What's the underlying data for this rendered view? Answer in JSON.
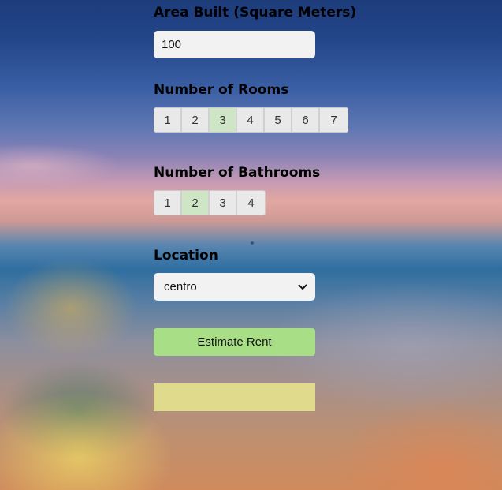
{
  "area": {
    "label": "Area Built (Square Meters)",
    "value": "100"
  },
  "rooms": {
    "label": "Number of Rooms",
    "options": [
      "1",
      "2",
      "3",
      "4",
      "5",
      "6",
      "7"
    ],
    "selected": "3"
  },
  "bathrooms": {
    "label": "Number of Bathrooms",
    "options": [
      "1",
      "2",
      "3",
      "4"
    ],
    "selected": "2"
  },
  "location": {
    "label": "Location",
    "selected": "centro"
  },
  "estimate_button": {
    "label": "Estimate Rent"
  },
  "colors": {
    "selected_option": "#cfe6c6",
    "button": "#a8df86",
    "result_box": "#e0da8c"
  }
}
